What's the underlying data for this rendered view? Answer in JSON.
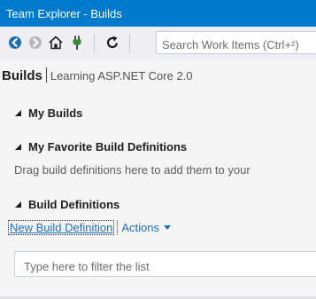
{
  "window": {
    "title": "Team Explorer - Builds"
  },
  "toolbar": {
    "buttons": [
      {
        "icon": "back-icon",
        "enabled": true,
        "color": "#1e6fb8"
      },
      {
        "icon": "forward-icon",
        "enabled": false,
        "color": "#b0b0b0"
      },
      {
        "icon": "home-icon",
        "enabled": true,
        "color": "#1e1e1e"
      },
      {
        "icon": "connect-icon",
        "enabled": true,
        "color": "#388a34"
      },
      {
        "icon": "refresh-icon",
        "enabled": true,
        "color": "#1e1e1e"
      }
    ],
    "search_placeholder": "Search Work Items (Ctrl+²)"
  },
  "header": {
    "title": "Builds",
    "project": "Learning ASP.NET Core 2.0"
  },
  "sections": {
    "my_builds": {
      "label": "My Builds",
      "expanded": true
    },
    "favorites": {
      "label": "My Favorite Build Definitions",
      "expanded": true,
      "hint": "Drag build definitions here to add them to your"
    },
    "definitions": {
      "label": "Build Definitions",
      "expanded": true,
      "new_link": "New Build Definition",
      "actions_link": "Actions",
      "filter_placeholder": "Type here to filter the list"
    }
  },
  "colors": {
    "accent": "#007acc",
    "link": "#1e6fb8",
    "background": "#f5f5f5"
  }
}
